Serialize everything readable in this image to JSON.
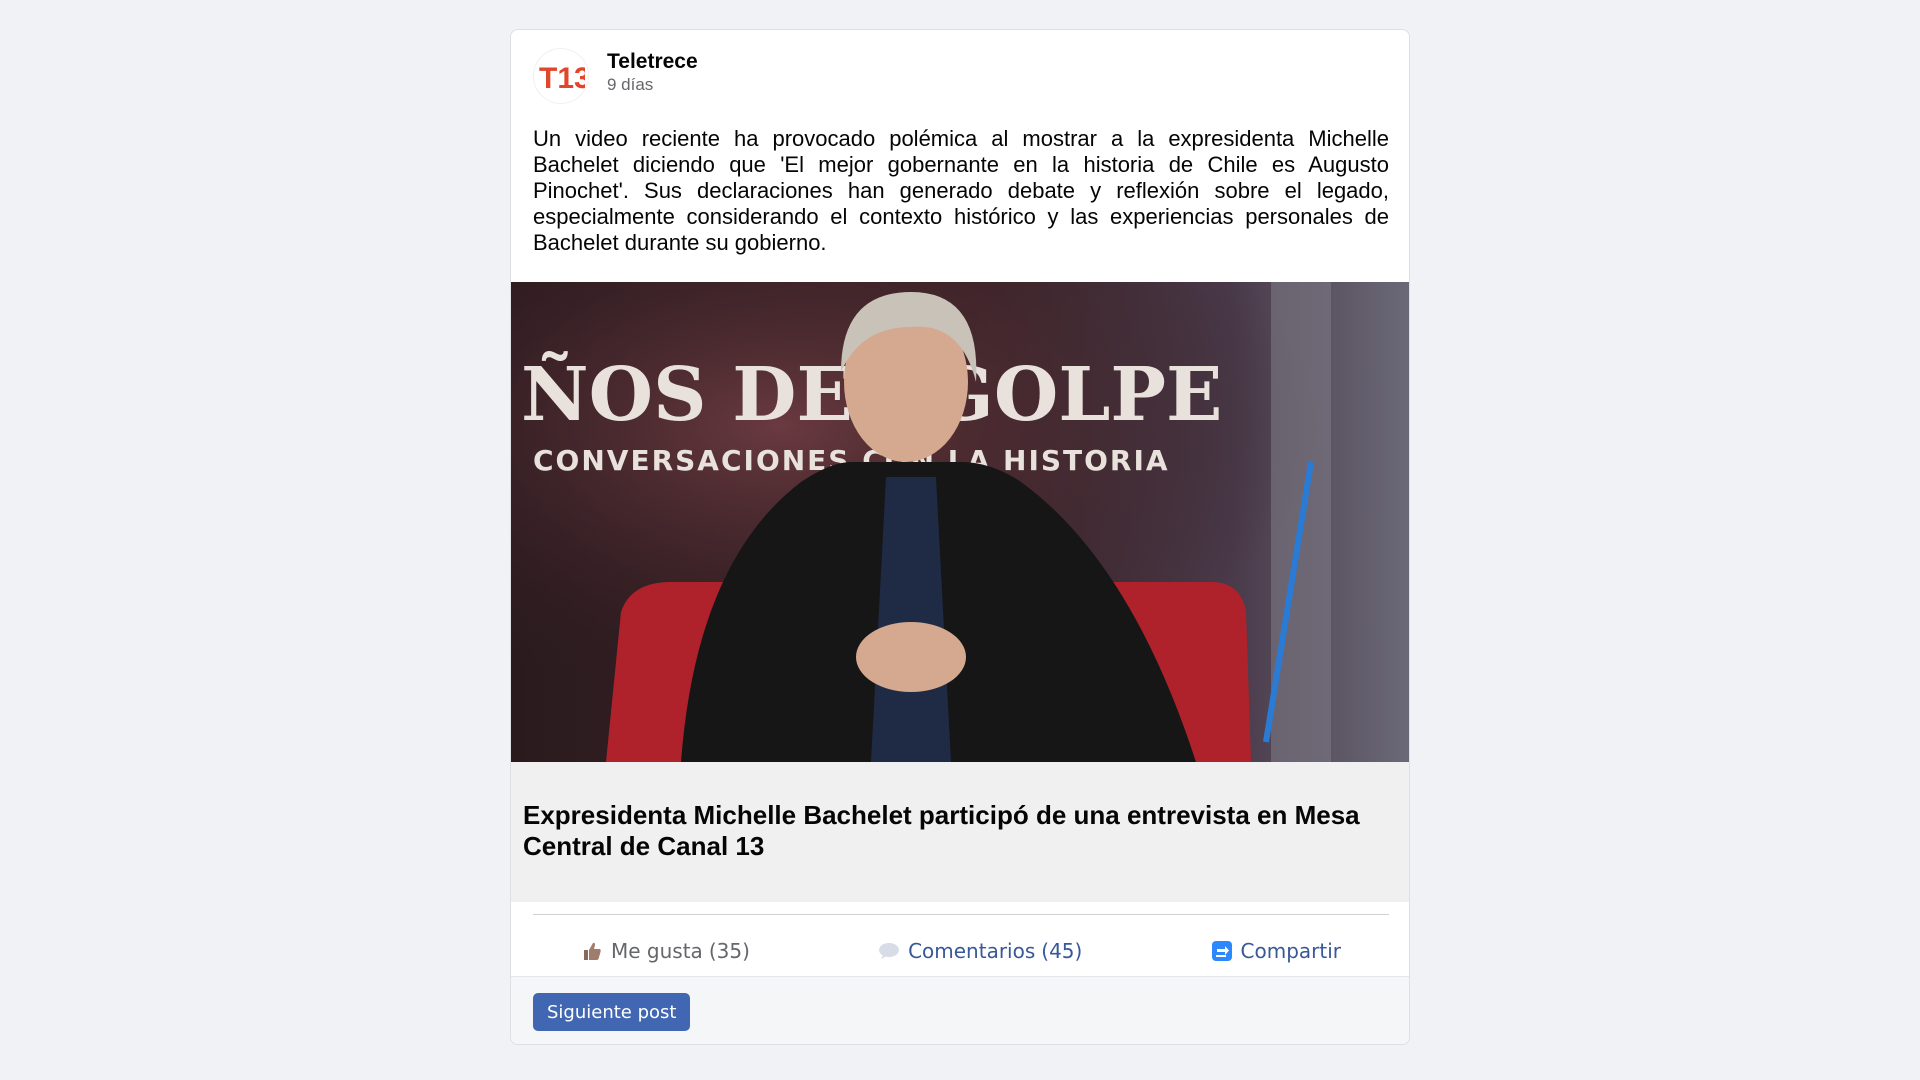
{
  "post": {
    "author": "Teletrece",
    "time": "9 días",
    "text": "Un video reciente ha provocado polémica al mostrar a la expresidenta Michelle Bachelet diciendo que 'El mejor gobernante en la historia de Chile es Augusto Pinochet'. Sus declaraciones han generado debate y reflexión sobre el legado, especialmente considerando el contexto histórico y las experiencias personales de Bachelet durante su gobierno.",
    "media": {
      "backdrop_line1": "ÑOS DEL GOLPE",
      "backdrop_line2": "CONVERSACIONES CON LA HISTORIA"
    },
    "link_title": "Expresidenta Michelle Bachelet participó de una entrevista en Mesa Central de Canal 13"
  },
  "logo": {
    "text": "T13",
    "color": "#e2462a"
  },
  "actions": {
    "like_label": "Me gusta",
    "like_count": "(35)",
    "comment_label": "Comentarios",
    "comment_count": "(45)",
    "share_label": "Compartir"
  },
  "footer": {
    "next_label": "Siguiente post"
  },
  "icons": {
    "like": "thumbs-up-icon",
    "comment": "speech-bubble-icon",
    "share": "share-arrow-icon"
  },
  "colors": {
    "accent": "#4267b2",
    "link": "#385898",
    "background": "#f1f2f5"
  }
}
